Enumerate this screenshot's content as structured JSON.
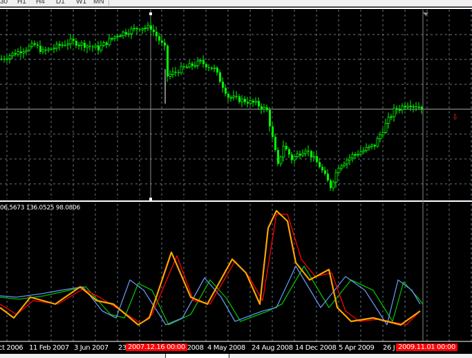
{
  "timeframes": [
    "30",
    "H1",
    "H4",
    "D1",
    "W1",
    "MN"
  ],
  "indicator": {
    "values_label": "06,5673 136.0525 98.0806"
  },
  "time_axis": {
    "labels": [
      "ct 2006",
      "11 Feb 2007",
      "3 Jun 2007",
      "23",
      "n 2008",
      "4 May 2008",
      "24 Aug 2008",
      "14 Dec 2008",
      "5 Apr 2009",
      "26 J"
    ],
    "cursor_labels": [
      "2007.12.16 00:00",
      "2009.11.01 00:00"
    ]
  },
  "colors": {
    "bull": "#00ff00",
    "orange": "#ffa500",
    "red": "#ff0000",
    "blue": "#6495ed",
    "green": "#00c000",
    "grid": "#6a7a88"
  },
  "chart_data": {
    "type": "line",
    "title": "Weekly price chart with oscillator",
    "price_keypoints": [
      [
        0,
        215
      ],
      [
        12,
        235
      ],
      [
        15,
        225
      ],
      [
        25,
        240
      ],
      [
        35,
        230
      ],
      [
        42,
        250
      ],
      [
        50,
        260
      ],
      [
        54,
        260
      ],
      [
        59,
        230
      ],
      [
        60,
        190
      ],
      [
        65,
        200
      ],
      [
        72,
        210
      ],
      [
        77,
        200
      ],
      [
        82,
        160
      ],
      [
        92,
        150
      ],
      [
        96,
        140
      ],
      [
        100,
        60
      ],
      [
        102,
        90
      ],
      [
        105,
        70
      ],
      [
        110,
        85
      ],
      [
        115,
        60
      ],
      [
        119,
        30
      ],
      [
        122,
        60
      ],
      [
        127,
        75
      ],
      [
        135,
        90
      ],
      [
        139,
        120
      ],
      [
        142,
        140
      ],
      [
        147,
        150
      ],
      [
        152,
        145
      ]
    ],
    "series": [
      {
        "name": "orange",
        "values": [
          [
            0,
            45
          ],
          [
            5,
            30
          ],
          [
            11,
            60
          ],
          [
            20,
            50
          ],
          [
            29,
            75
          ],
          [
            35,
            55
          ],
          [
            41,
            50
          ],
          [
            50,
            20
          ],
          [
            54,
            30
          ],
          [
            62,
            125
          ],
          [
            69,
            60
          ],
          [
            75,
            50
          ],
          [
            84,
            115
          ],
          [
            89,
            95
          ],
          [
            94,
            50
          ],
          [
            97,
            160
          ],
          [
            100,
            185
          ],
          [
            104,
            170
          ],
          [
            107,
            110
          ],
          [
            112,
            85
          ],
          [
            119,
            100
          ],
          [
            122,
            45
          ],
          [
            127,
            25
          ],
          [
            135,
            30
          ],
          [
            145,
            20
          ],
          [
            152,
            40
          ]
        ]
      },
      {
        "name": "red",
        "values": [
          [
            0,
            50
          ],
          [
            6,
            35
          ],
          [
            12,
            55
          ],
          [
            21,
            50
          ],
          [
            30,
            72
          ],
          [
            36,
            60
          ],
          [
            42,
            45
          ],
          [
            51,
            22
          ],
          [
            55,
            35
          ],
          [
            64,
            120
          ],
          [
            70,
            55
          ],
          [
            76,
            50
          ],
          [
            85,
            112
          ],
          [
            90,
            90
          ],
          [
            95,
            55
          ],
          [
            100,
            180
          ],
          [
            104,
            180
          ],
          [
            109,
            115
          ],
          [
            114,
            90
          ],
          [
            120,
            95
          ],
          [
            125,
            40
          ],
          [
            130,
            25
          ],
          [
            137,
            28
          ],
          [
            147,
            20
          ],
          [
            152,
            40
          ]
        ]
      },
      {
        "name": "blue",
        "values": [
          [
            0,
            62
          ],
          [
            6,
            60
          ],
          [
            15,
            65
          ],
          [
            22,
            70
          ],
          [
            30,
            75
          ],
          [
            37,
            40
          ],
          [
            42,
            30
          ],
          [
            47,
            85
          ],
          [
            52,
            70
          ],
          [
            60,
            20
          ],
          [
            66,
            30
          ],
          [
            74,
            88
          ],
          [
            80,
            60
          ],
          [
            85,
            25
          ],
          [
            95,
            40
          ],
          [
            100,
            45
          ],
          [
            107,
            105
          ],
          [
            116,
            45
          ],
          [
            125,
            90
          ],
          [
            132,
            70
          ],
          [
            140,
            20
          ],
          [
            144,
            85
          ],
          [
            149,
            70
          ],
          [
            152,
            50
          ]
        ]
      },
      {
        "name": "green",
        "values": [
          [
            0,
            60
          ],
          [
            7,
            57
          ],
          [
            16,
            62
          ],
          [
            25,
            70
          ],
          [
            31,
            75
          ],
          [
            40,
            35
          ],
          [
            45,
            30
          ],
          [
            50,
            80
          ],
          [
            55,
            70
          ],
          [
            61,
            20
          ],
          [
            69,
            35
          ],
          [
            76,
            85
          ],
          [
            82,
            58
          ],
          [
            87,
            25
          ],
          [
            97,
            40
          ],
          [
            102,
            50
          ],
          [
            110,
            105
          ],
          [
            119,
            45
          ],
          [
            127,
            85
          ],
          [
            135,
            70
          ],
          [
            142,
            25
          ],
          [
            146,
            82
          ],
          [
            151,
            60
          ],
          [
            153,
            50
          ]
        ]
      }
    ]
  }
}
